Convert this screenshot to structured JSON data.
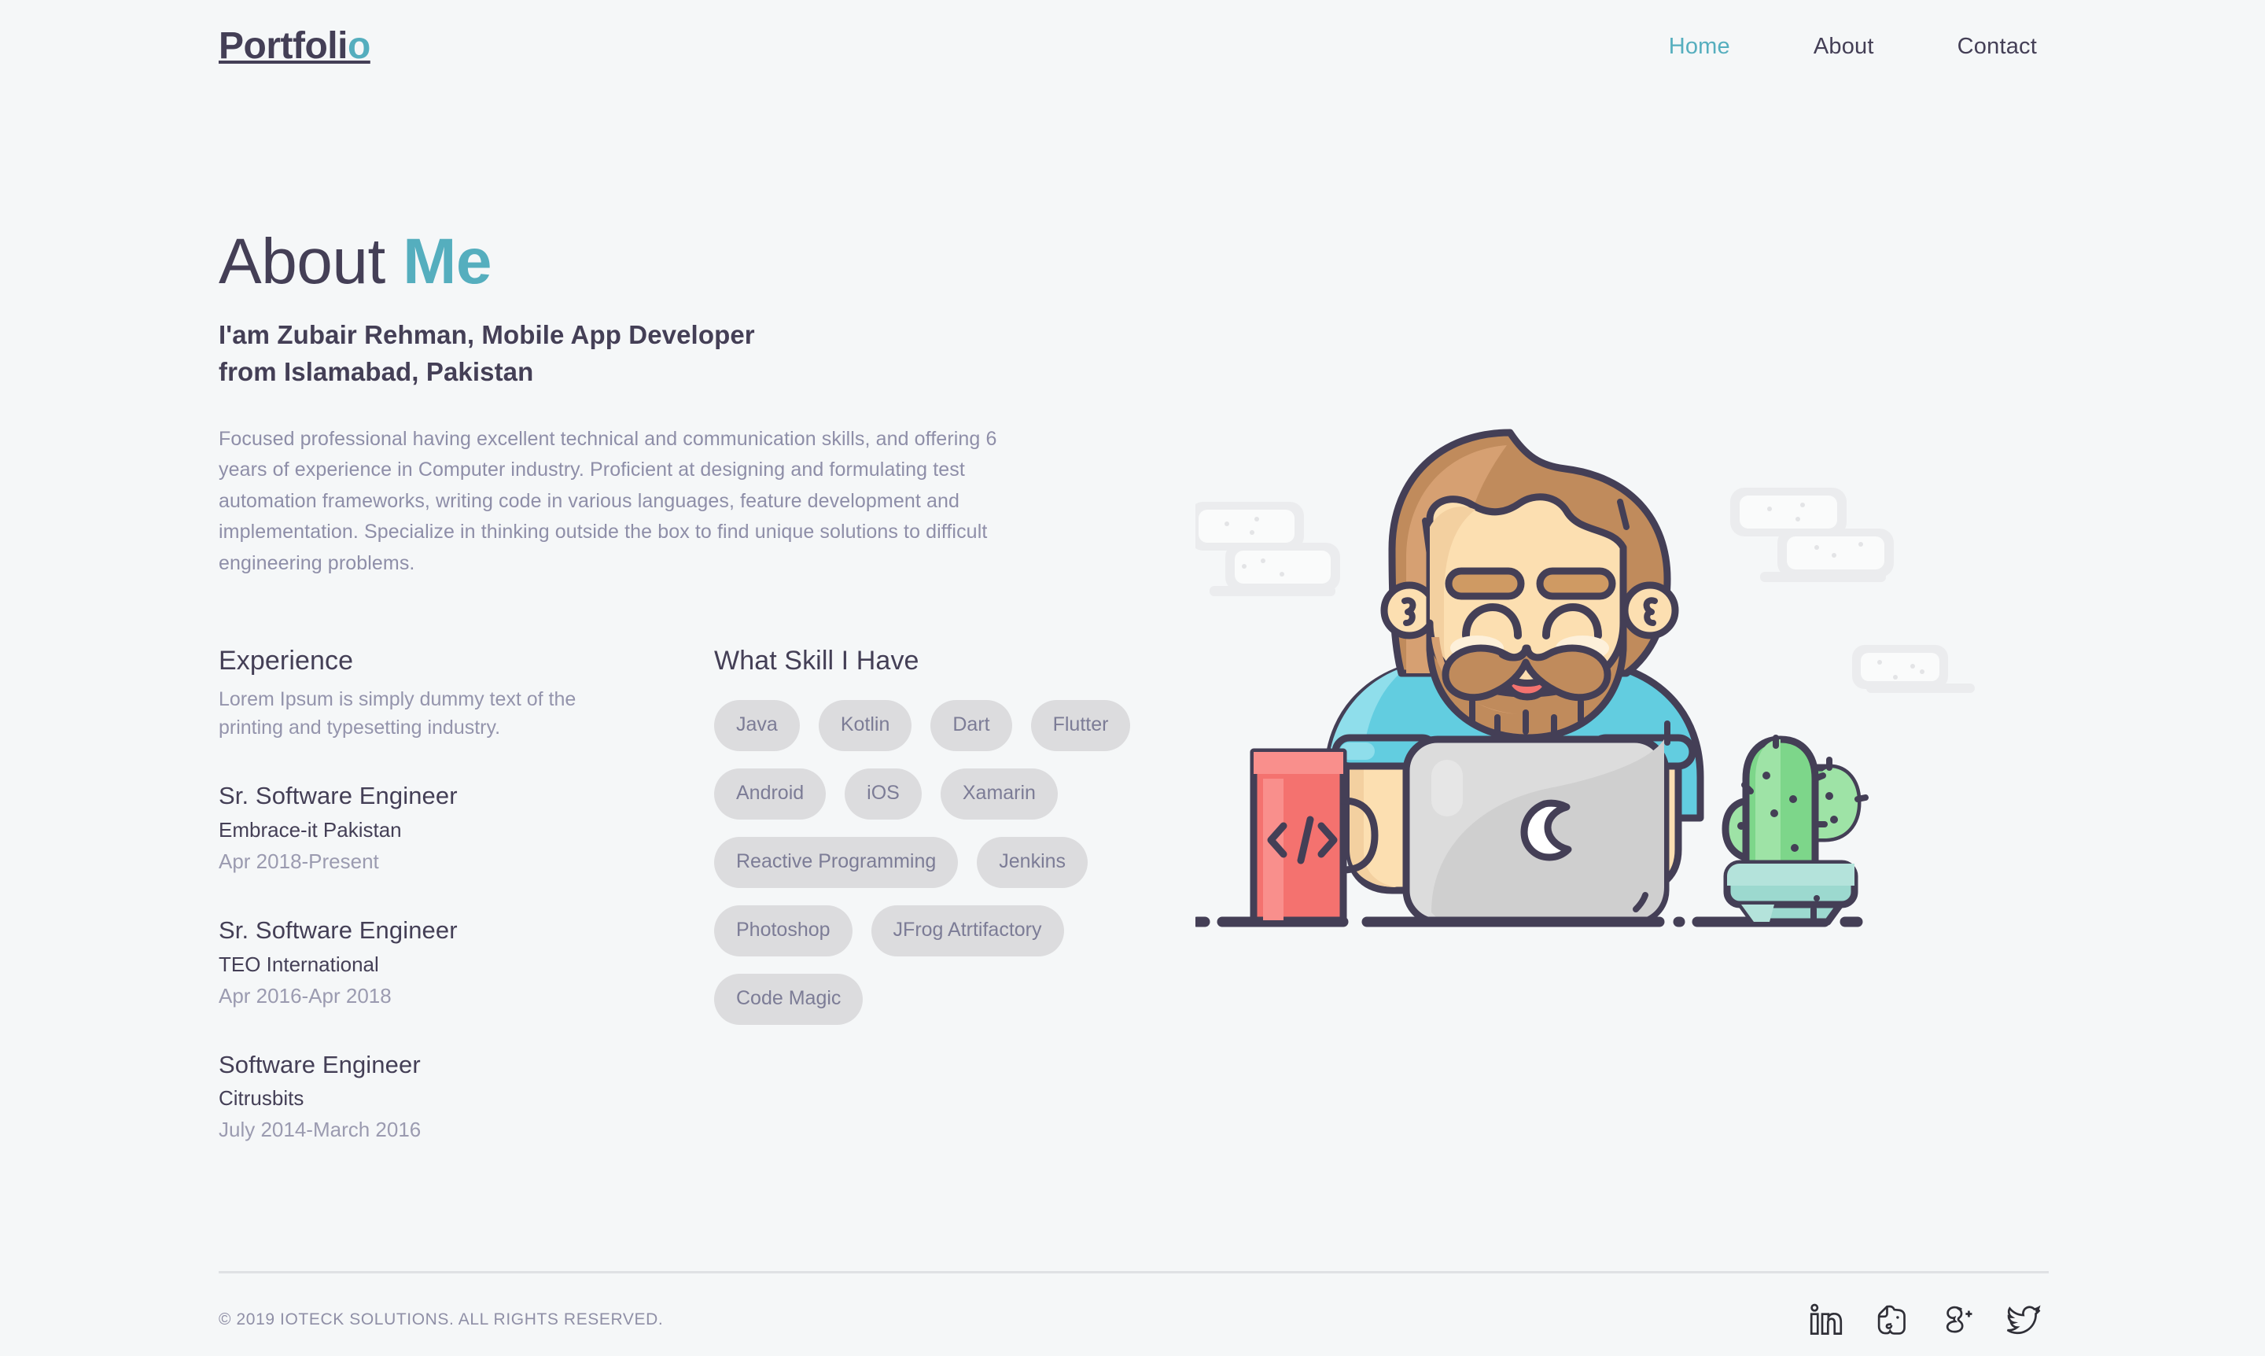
{
  "header": {
    "brand_main": "Portfoli",
    "brand_accent": "o",
    "nav": [
      {
        "label": "Home",
        "active": true
      },
      {
        "label": "About",
        "active": false
      },
      {
        "label": "Contact",
        "active": false
      }
    ]
  },
  "hero": {
    "title_main": "About",
    "title_accent": "Me",
    "tagline_line1": "I'am Zubair Rehman, Mobile App Developer",
    "tagline_line2": "from Islamabad, Pakistan",
    "paragraph": "Focused professional having excellent technical and communication skills, and offering 6 years of experience in Computer industry. Proficient at designing and formulating test automation frameworks, writing code in various languages, feature development and implementation. Specialize in thinking outside the box to find unique solutions to difficult engineering problems."
  },
  "experience": {
    "heading": "Experience",
    "subtitle": "Lorem Ipsum is simply dummy text of the printing and typesetting industry.",
    "jobs": [
      {
        "title": "Sr. Software Engineer",
        "company": "Embrace-it Pakistan",
        "dates": "Apr 2018-Present"
      },
      {
        "title": "Sr. Software Engineer",
        "company": "TEO International",
        "dates": "Apr 2016-Apr 2018"
      },
      {
        "title": "Software Engineer",
        "company": "Citrusbits",
        "dates": "July 2014-March 2016"
      }
    ]
  },
  "skills": {
    "heading": "What Skill I Have",
    "rows": [
      [
        "Java",
        "Kotlin",
        "Dart",
        "Flutter"
      ],
      [
        "Android",
        "iOS",
        "Xamarin"
      ],
      [
        "Reactive Programming",
        "Jenkins"
      ],
      [
        "Photoshop",
        "JFrog Atrtifactory"
      ],
      [
        "Code Magic"
      ]
    ]
  },
  "illustration": {
    "alt": "Bearded developer working on a laptop with a coffee mug and a cactus on the desk",
    "colors": {
      "outline": "#443f56",
      "hair": "#c08b5c",
      "hair_shadow": "#b07c4e",
      "skin": "#fcdfb1",
      "skin_shadow": "#f5d0a0",
      "shirt": "#62cde0",
      "shirt_light": "#8fdeeb",
      "laptop": "#dcdcdc",
      "laptop_shadow": "#cdcdcd",
      "mug": "#f4726f",
      "mug_light": "#f98f8c",
      "cactus": "#7dd68a",
      "cactus_light": "#9ee3a6",
      "pot": "#9cd9cf",
      "pot_light": "#b4e3db",
      "ghost_window": "#ebecee",
      "ghost_window_fill": "#fafbfb"
    }
  },
  "footer": {
    "copyright": "© 2019 IOTECK SOLUTIONS. ALL RIGHTS RESERVED.",
    "social": [
      {
        "name": "linkedin",
        "label": "LinkedIn"
      },
      {
        "name": "evernote",
        "label": "Evernote"
      },
      {
        "name": "google-plus",
        "label": "Google Plus"
      },
      {
        "name": "twitter",
        "label": "Twitter"
      }
    ]
  },
  "theme": {
    "background": "#f5f7f8",
    "text_dark": "#443f56",
    "text_muted": "#8e8ea8",
    "accent": "#55aebe",
    "pill_bg": "#dcdcde",
    "pill_text": "#7c7c96",
    "divider": "#dfe1e4"
  }
}
